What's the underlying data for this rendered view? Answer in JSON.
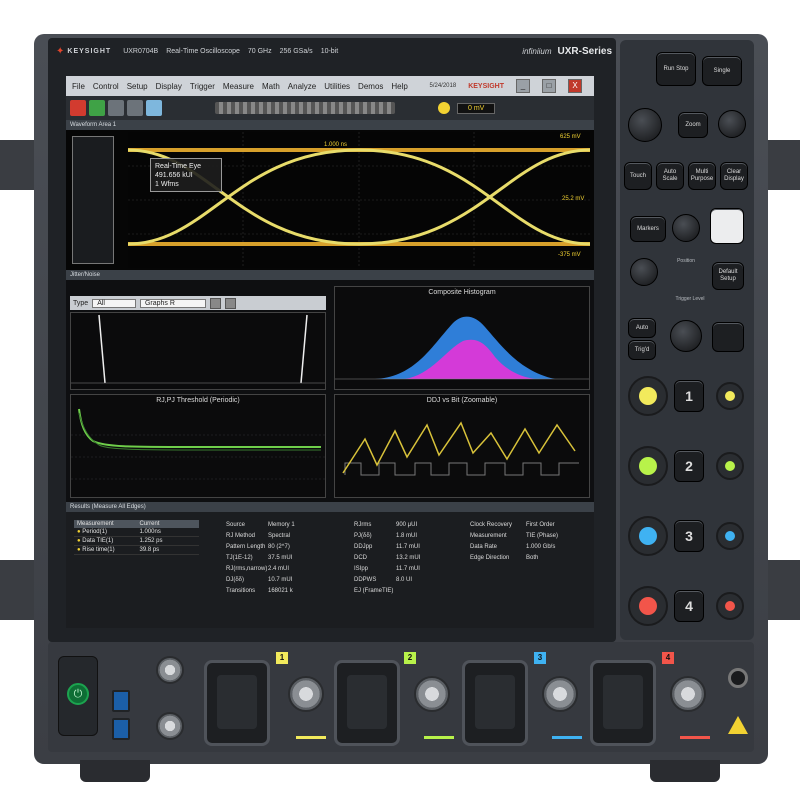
{
  "brand": {
    "company": "KEYSIGHT",
    "model": "UXR0704B",
    "description": "Real-Time Oscilloscope",
    "spec1": "70 GHz",
    "spec2": "256 GSa/s",
    "spec3": "10-bit",
    "software": "infiniium",
    "series": "UXR-Series"
  },
  "menubar": {
    "items": [
      "File",
      "Control",
      "Setup",
      "Display",
      "Trigger",
      "Measure",
      "Math",
      "Analyze",
      "Utilities",
      "Demos",
      "Help"
    ],
    "date": "5/24/2018",
    "brand": "KEYSIGHT",
    "close_glyph": "X"
  },
  "toolbar": {
    "trigger_value": "0 mV"
  },
  "waveform_area": {
    "title": "Waveform Area 1",
    "meas_box": [
      "Real-Time Eye",
      "491.656 kUI",
      "1 Wfms"
    ],
    "right_labels": [
      "625 mV",
      "25.2 mV",
      "-375 mV"
    ],
    "center_label": "1.000 ns"
  },
  "jitter_pane": {
    "title": "Jitter/Noise",
    "type_label": "Type",
    "type_value": "All",
    "graph_value": "Graphs R"
  },
  "subplots": {
    "composite": "Composite Histogram",
    "rj": "RJ,PJ Threshold (Periodic)",
    "ddj": "DDJ vs Bit (Zoomable)"
  },
  "results": {
    "title": "Results  (Measure All Edges)",
    "headers": [
      "Measurement",
      "Current"
    ],
    "rows": [
      {
        "name": "Period(1)",
        "value": "1.000ns"
      },
      {
        "name": "Data TIE(1)",
        "value": "1.252 ps"
      },
      {
        "name": "Rise time(1)",
        "value": "39.8 ps"
      }
    ],
    "col2": [
      {
        "k": "Source",
        "v": "Memory 1"
      },
      {
        "k": "RJ Method",
        "v": "Spectral"
      },
      {
        "k": "Pattern Length",
        "v": "80 (2^7)"
      },
      {
        "k": "TJ(1E-12)",
        "v": "37.5 mUI"
      },
      {
        "k": "RJ(rms,narrow)",
        "v": "2.4 mUI"
      },
      {
        "k": "DJ(δδ)",
        "v": "10.7 mUI"
      },
      {
        "k": "Transitions",
        "v": "168021 k"
      }
    ],
    "col3": [
      {
        "k": "RJrms",
        "v": "900 μUI"
      },
      {
        "k": "PJ(δδ)",
        "v": "1.8 mUI"
      },
      {
        "k": "DDJpp",
        "v": "11.7 mUI"
      },
      {
        "k": "DCD",
        "v": "13.2 mUI"
      },
      {
        "k": "ISIpp",
        "v": "11.7 mUI"
      },
      {
        "k": "DDPWS",
        "v": "8.0 UI"
      },
      {
        "k": "EJ (FrameTIE)",
        "v": ""
      }
    ],
    "col4": [
      {
        "k": "Clock Recovery",
        "v": "First Order"
      },
      {
        "k": "Measurement",
        "v": "TIE (Phase)"
      },
      {
        "k": "Data Rate",
        "v": "1.000 Gb/s"
      },
      {
        "k": "Edge Direction",
        "v": "Both"
      }
    ]
  },
  "front_panel": {
    "run_stop": "Run Stop",
    "single": "Single",
    "zoom": "Zoom",
    "touch": "Touch",
    "auto_scale": "Auto Scale",
    "multi_purpose": "Multi Purpose",
    "clear_display": "Clear Display",
    "markers": "Markers",
    "position": "Position",
    "default_setup": "Default Setup",
    "trigger_level": "Trigger Level",
    "auto": "Auto",
    "trig_d": "Trig'd",
    "channels": [
      "1",
      "2",
      "3",
      "4"
    ],
    "channel_colors": [
      "#f2ea5c",
      "#b8f24a",
      "#3fb2f2",
      "#f2554a"
    ]
  },
  "bottom": {
    "channel_tags": [
      "1",
      "2",
      "3",
      "4"
    ]
  }
}
